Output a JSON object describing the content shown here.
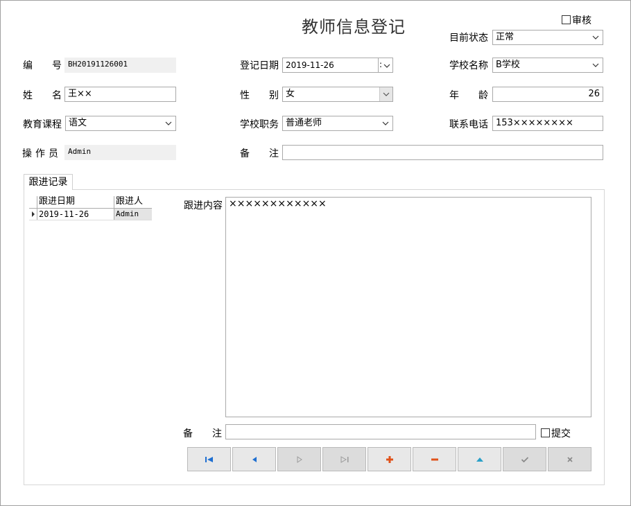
{
  "title": "教师信息登记",
  "audit": {
    "label": "审核",
    "checked": false
  },
  "status": {
    "label": "目前状态",
    "value": "正常"
  },
  "fields": {
    "number": {
      "label1": "编",
      "label2": "号",
      "value": "BH20191126001"
    },
    "reg_date": {
      "label": "登记日期",
      "value": "2019-11-26"
    },
    "school_name": {
      "label": "学校名称",
      "value": "B学校"
    },
    "name": {
      "label1": "姓",
      "label2": "名",
      "value": "王××"
    },
    "gender": {
      "label1": "性",
      "label2": "别",
      "value": "女"
    },
    "age": {
      "label1": "年",
      "label2": "龄",
      "value": "26"
    },
    "course": {
      "label": "教育课程",
      "value": "语文"
    },
    "duty": {
      "label": "学校职务",
      "value": "普通老师"
    },
    "phone": {
      "label": "联系电话",
      "value": "153××××××××"
    },
    "operator": {
      "label1": "操",
      "label2": "作",
      "label3": "员",
      "value": "Admin"
    },
    "remark": {
      "label1": "备",
      "label2": "注",
      "value": ""
    }
  },
  "followup": {
    "tab_label": "跟进记录",
    "columns": [
      "跟进日期",
      "跟进人"
    ],
    "rows": [
      {
        "date": "2019-11-26",
        "person": "Admin"
      }
    ],
    "content_label": "跟进内容",
    "content_value": "××××××××××××",
    "remark_label1": "备",
    "remark_label2": "注",
    "remark_value": "",
    "submit": {
      "label": "提交",
      "checked": false
    }
  },
  "nav_buttons": [
    {
      "name": "first-record",
      "icon": "first-icon",
      "color": "#1f6fd1"
    },
    {
      "name": "prev-record",
      "icon": "prev-icon",
      "color": "#1f6fd1"
    },
    {
      "name": "next-record",
      "icon": "next-icon",
      "color": "#9a9a9a"
    },
    {
      "name": "last-record",
      "icon": "last-icon",
      "color": "#9a9a9a"
    },
    {
      "name": "add-record",
      "icon": "plus-icon",
      "color": "#e0521a"
    },
    {
      "name": "delete-record",
      "icon": "minus-icon",
      "color": "#e0521a"
    },
    {
      "name": "edit-record",
      "icon": "up-icon",
      "color": "#2aa0c8"
    },
    {
      "name": "post-record",
      "icon": "check-icon",
      "color": "#8a8a8a"
    },
    {
      "name": "cancel-record",
      "icon": "cross-icon",
      "color": "#8a8a8a"
    }
  ]
}
